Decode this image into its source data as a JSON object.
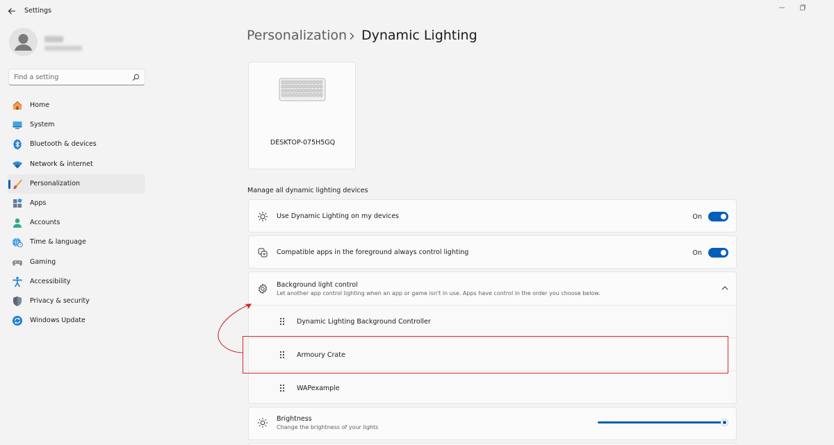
{
  "window": {
    "title": "Settings"
  },
  "search": {
    "placeholder": "Find a setting"
  },
  "nav": [
    {
      "label": "Home",
      "icon": "home-icon"
    },
    {
      "label": "System",
      "icon": "system-icon"
    },
    {
      "label": "Bluetooth & devices",
      "icon": "bluetooth-icon"
    },
    {
      "label": "Network & internet",
      "icon": "wifi-icon"
    },
    {
      "label": "Personalization",
      "icon": "brush-icon",
      "active": true
    },
    {
      "label": "Apps",
      "icon": "apps-icon"
    },
    {
      "label": "Accounts",
      "icon": "accounts-icon"
    },
    {
      "label": "Time & language",
      "icon": "globe-clock-icon"
    },
    {
      "label": "Gaming",
      "icon": "gamepad-icon"
    },
    {
      "label": "Accessibility",
      "icon": "accessibility-icon"
    },
    {
      "label": "Privacy & security",
      "icon": "shield-icon"
    },
    {
      "label": "Windows Update",
      "icon": "update-icon"
    }
  ],
  "breadcrumb": {
    "parent": "Personalization",
    "current": "Dynamic Lighting"
  },
  "device": {
    "name": "DESKTOP-075H5GQ",
    "icon": "keyboard-icon"
  },
  "section": {
    "title": "Manage all dynamic lighting devices"
  },
  "settings": {
    "use_dynamic": {
      "label": "Use Dynamic Lighting on my devices",
      "state": "On",
      "icon": "sun-burst-icon"
    },
    "compatible_apps": {
      "label": "Compatible apps in the foreground always control lighting",
      "state": "On",
      "icon": "apps-overlap-icon"
    },
    "background_control": {
      "label": "Background light control",
      "description": "Let another app control lighting when an app or game isn't in use. Apps have control in the order you choose below.",
      "icon": "gear-icon",
      "apps": [
        "Dynamic Lighting Background Controller",
        "Armoury Crate",
        "WAPexample"
      ]
    },
    "brightness": {
      "label": "Brightness",
      "description": "Change the brightness of your lights",
      "icon": "brightness-icon",
      "value": 1.0
    }
  },
  "colors": {
    "accent": "#005fb8",
    "annotation": "#e02424"
  }
}
